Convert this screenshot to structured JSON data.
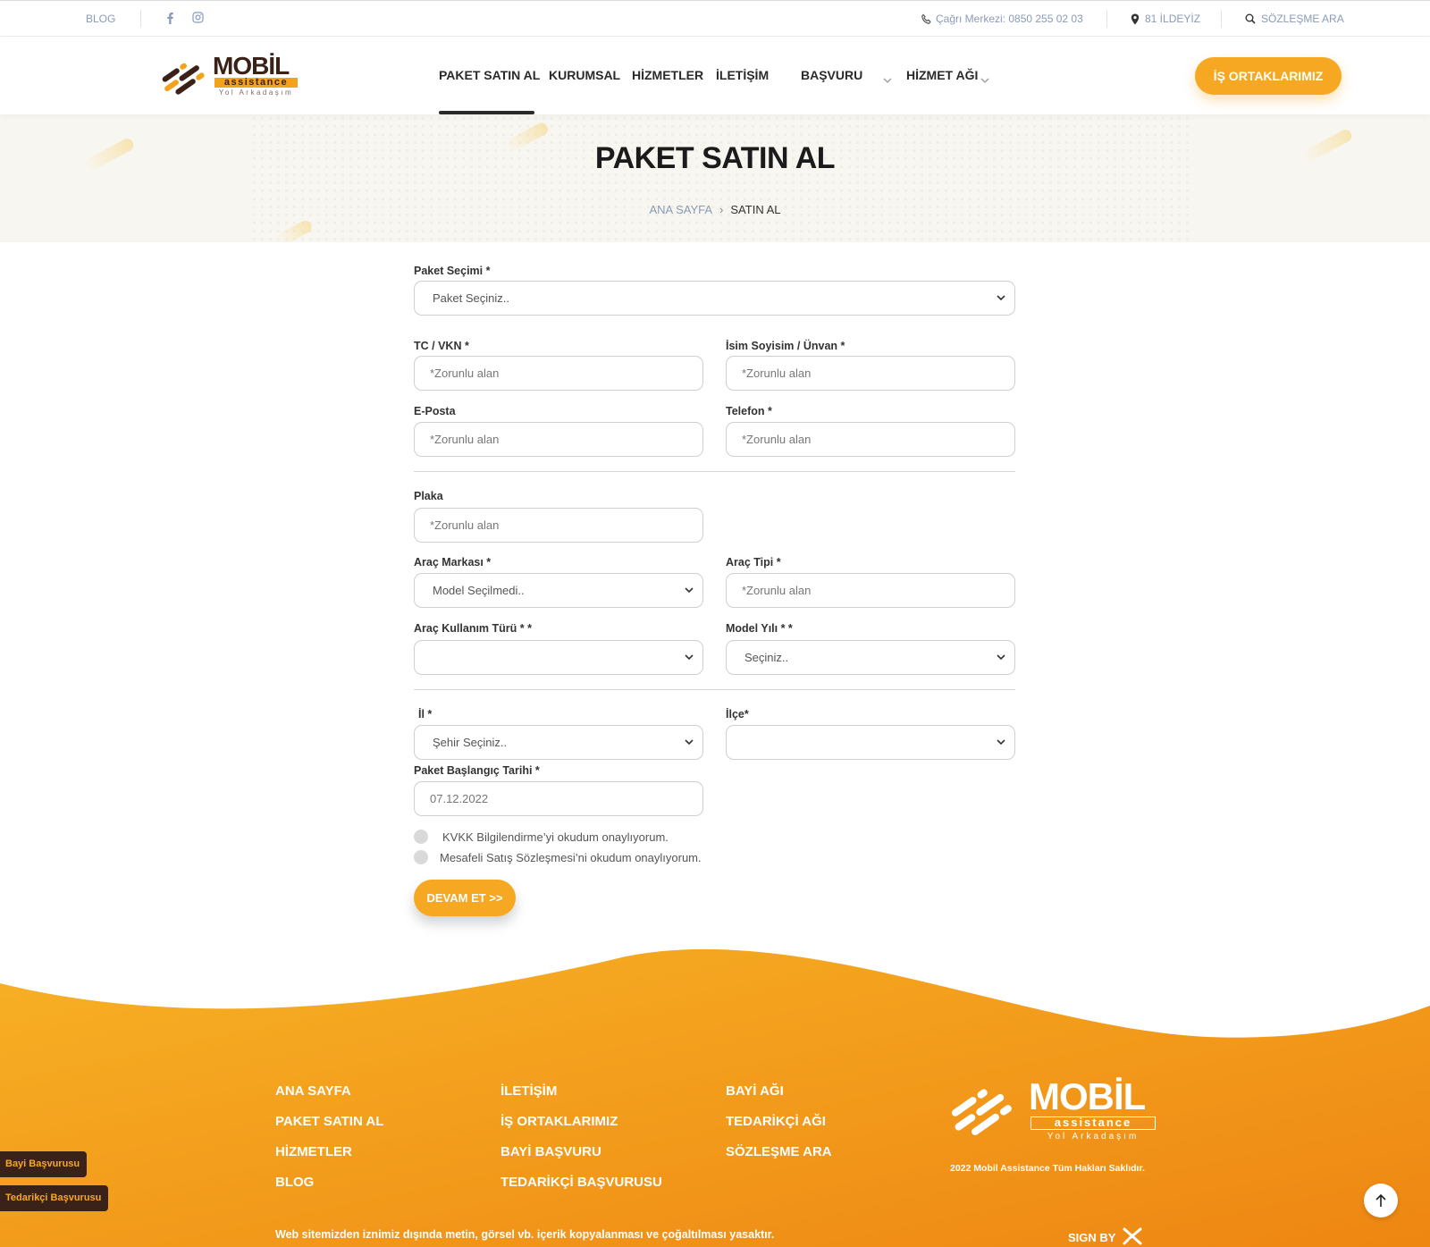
{
  "topbar": {
    "blog": "BLOG",
    "call_center": "Çağrı Merkezi: 0850 255 02 03",
    "location": "81 İLDEYİZ",
    "contract_search": "SÖZLEŞME ARA"
  },
  "header": {
    "logo_word": "MOBİL",
    "logo_sub": "assistance",
    "logo_tag": "Yol Arkadaşım",
    "nav": {
      "buy": "PAKET SATIN AL",
      "corporate": "KURUMSAL",
      "services": "HİZMETLER",
      "contact": "İLETİŞİM",
      "apply": "BAŞVURU",
      "network": "HİZMET AĞI"
    },
    "partners_button": "İŞ ORTAKLARIMIZ"
  },
  "hero": {
    "title": "PAKET SATIN AL",
    "breadcrumb_home": "ANA SAYFA",
    "breadcrumb_current": "SATIN AL"
  },
  "form": {
    "package_label": "Paket Seçimi *",
    "package_value": "Paket Seçiniz..",
    "tc_label": "TC / VKN *",
    "tc_placeholder": "*Zorunlu alan",
    "name_label": "İsim Soyisim / Ünvan *",
    "name_placeholder": "*Zorunlu alan",
    "email_label": "E-Posta",
    "email_placeholder": "*Zorunlu alan",
    "phone_label": "Telefon *",
    "phone_placeholder": "*Zorunlu alan",
    "plate_label": "Plaka",
    "plate_placeholder": "*Zorunlu alan",
    "brand_label": "Araç Markası *",
    "brand_value": "Model Seçilmedi..",
    "type_label": "Araç Tipi *",
    "type_placeholder": "*Zorunlu alan",
    "usage_label": "Araç Kullanım Türü * *",
    "usage_value": "",
    "year_label": "Model Yılı * *",
    "year_value": "Seçiniz..",
    "city_label": "İl *",
    "city_value": "Şehir Seçiniz..",
    "district_label": "İlçe*",
    "district_value": "",
    "start_label": "Paket Başlangıç Tarihi *",
    "start_value": "07.12.2022",
    "kvkk": "KVKK Bilgilendirme’yi okudum onaylıyorum.",
    "distance_sales": "Mesafeli Satış Sözleşmesi’ni okudum onaylıyorum.",
    "continue_button": "DEVAM ET >>"
  },
  "footer": {
    "links_col1": [
      "ANA SAYFA",
      "PAKET SATIN AL",
      "HİZMETLER",
      "BLOG"
    ],
    "links_col2": [
      "İLETİŞİM",
      "İŞ ORTAKLARIMIZ",
      "BAYİ BAŞVURU",
      "TEDARİKÇİ BAŞVURUSU"
    ],
    "links_col3": [
      "BAYİ AĞI",
      "TEDARİKÇİ AĞI",
      "SÖZLEŞME ARA"
    ],
    "logo_word": "MOBİL",
    "logo_sub": "assistance",
    "logo_tag": "Yol Arkadaşım",
    "copyright": "2022 Mobil Assistance Tüm Hakları Saklıdır.",
    "legal": "Web sitemizden iznimiz dışında metin, görsel vb. içerik kopyalanması ve çoğaltılması yasaktır.",
    "sign_by": "SIGN BY"
  },
  "floating": {
    "dealer_apply": "Bayi Başvurusu",
    "supplier_apply": "Tedarikçi Başvurusu"
  },
  "colors": {
    "accent": "#f6a822",
    "brand_dark": "#3a2218",
    "footer_start": "#f7ae22",
    "footer_end": "#ef8a14"
  }
}
